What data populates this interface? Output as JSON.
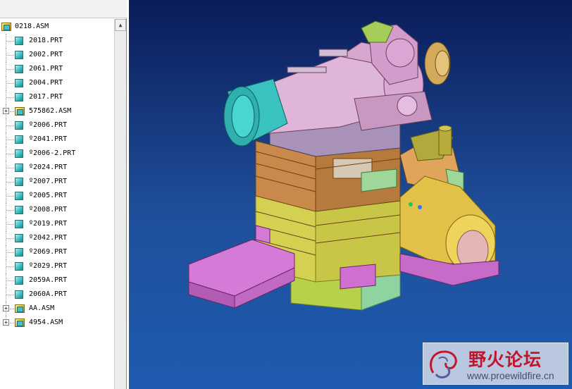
{
  "model_tree": {
    "root": "0218.ASM",
    "items": [
      {
        "label": "2018.PRT",
        "type": "part",
        "expandable": false
      },
      {
        "label": "2002.PRT",
        "type": "part",
        "expandable": false
      },
      {
        "label": "2061.PRT",
        "type": "part",
        "expandable": false
      },
      {
        "label": "2004.PRT",
        "type": "part",
        "expandable": false
      },
      {
        "label": "2017.PRT",
        "type": "part",
        "expandable": false
      },
      {
        "label": "575862.ASM",
        "type": "assembly",
        "expandable": true
      },
      {
        "label": "º2006.PRT",
        "type": "part",
        "expandable": false
      },
      {
        "label": "º2041.PRT",
        "type": "part",
        "expandable": false
      },
      {
        "label": "º2006-2.PRT",
        "type": "part",
        "expandable": false
      },
      {
        "label": "º2024.PRT",
        "type": "part",
        "expandable": false
      },
      {
        "label": "º2007.PRT",
        "type": "part",
        "expandable": false
      },
      {
        "label": "º2005.PRT",
        "type": "part",
        "expandable": false
      },
      {
        "label": "º2008.PRT",
        "type": "part",
        "expandable": false
      },
      {
        "label": "º2019.PRT",
        "type": "part",
        "expandable": false
      },
      {
        "label": "º2042.PRT",
        "type": "part",
        "expandable": false
      },
      {
        "label": "º2069.PRT",
        "type": "part",
        "expandable": false
      },
      {
        "label": "º2029.PRT",
        "type": "part",
        "expandable": false
      },
      {
        "label": "2059A.PRT",
        "type": "part",
        "expandable": false
      },
      {
        "label": "2060A.PRT",
        "type": "part",
        "expandable": false
      },
      {
        "label": "AA.ASM",
        "type": "assembly",
        "expandable": true
      },
      {
        "label": "4954.ASM",
        "type": "assembly",
        "expandable": true
      }
    ]
  },
  "watermark": {
    "title": "野火论坛",
    "url": "www.proewildfire.cn"
  },
  "colors": {
    "viewport_top": "#0a1c5a",
    "viewport_bottom": "#1e5bb0",
    "part_icon": "#3cb8c0",
    "assembly_icon": "#e8c23a",
    "watermark_text": "#c0162b"
  },
  "icons": {
    "part": "part-icon",
    "assembly": "assembly-icon",
    "expand": "expand-plus-icon",
    "scroll_up": "scroll-up-arrow-icon"
  }
}
